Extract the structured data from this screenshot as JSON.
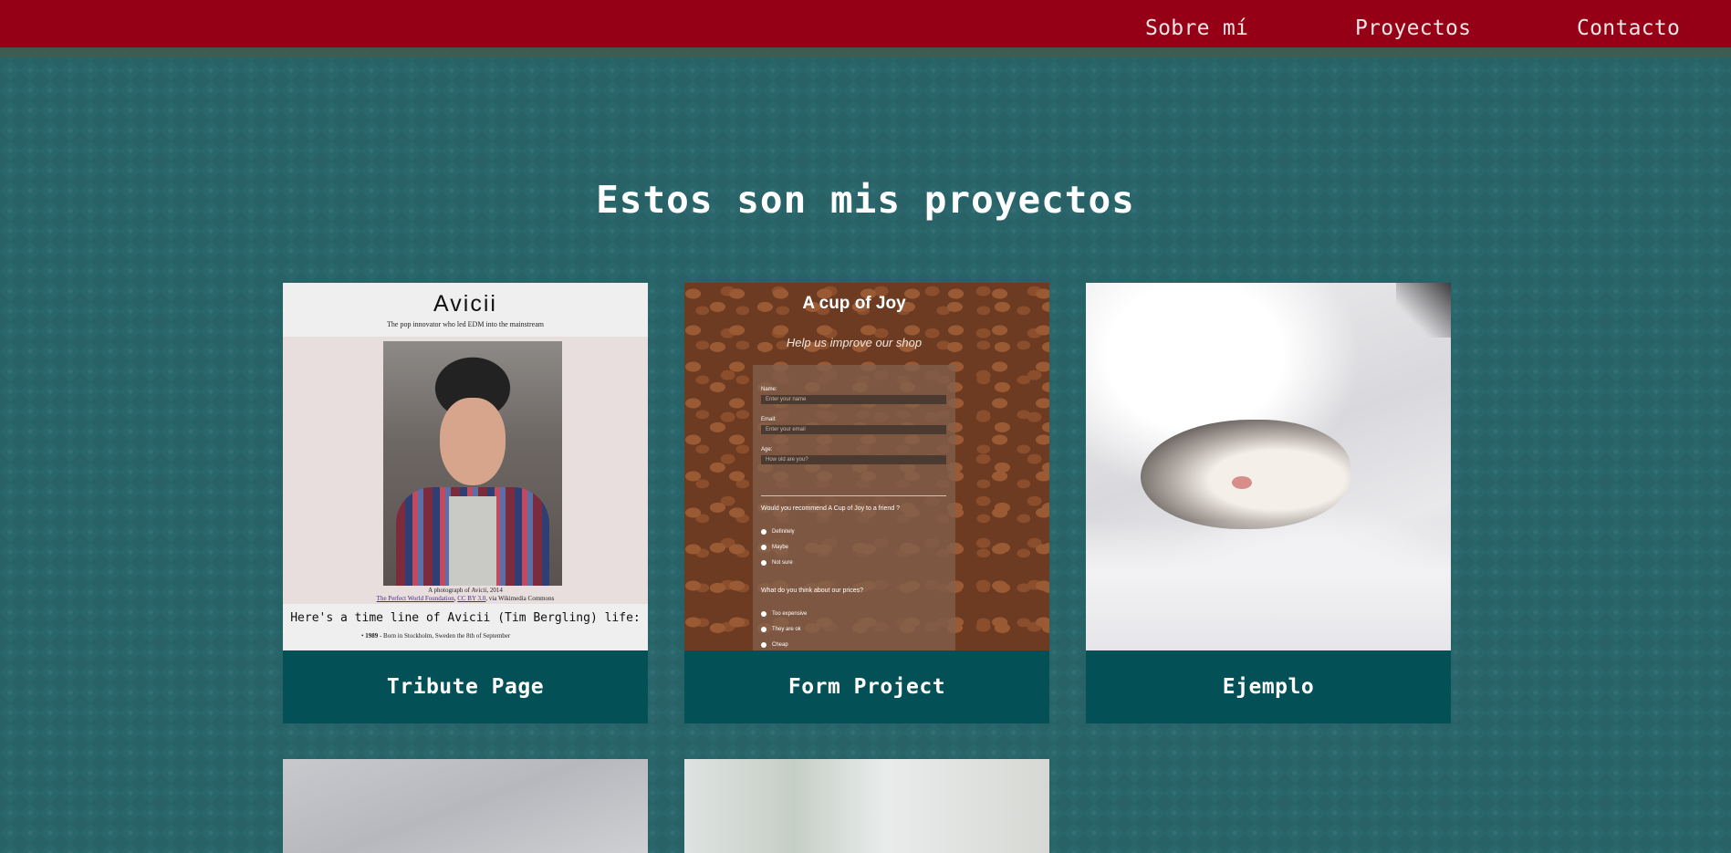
{
  "nav": {
    "links": [
      "Sobre mí",
      "Proyectos",
      "Contacto"
    ]
  },
  "colors": {
    "navbar": "#960016",
    "navbar_border": "#3b5d52",
    "background": "#2a676d",
    "caption": "#035156",
    "text": "#ffffff"
  },
  "projects": {
    "title": "Estos son mis proyectos",
    "cards": [
      {
        "caption": "Tribute Page",
        "thumb": {
          "title": "Avicii",
          "subtitle": "The pop innovator who led EDM into the mainstream",
          "photo_caption_line1": "A photograph of Avicii, 2014",
          "photo_caption_link1": "The Perfect World Foundation",
          "photo_caption_link2": "CC BY 3.0",
          "photo_caption_tail": ", via Wikimedia Commons",
          "timeline_heading": "Here's a time line of Avicii (Tim Bergling) life:",
          "timeline_year": "1989",
          "timeline_text": " - Born in Stockholm, Sweden the 8th of September"
        }
      },
      {
        "caption": "Form Project",
        "thumb": {
          "title": "A cup of Joy",
          "subtitle": "Help us improve our shop",
          "name_label": "Name:",
          "name_placeholder": "Enter your name",
          "email_label": "Email:",
          "email_placeholder": "Enter your email",
          "age_label": "Age:",
          "age_placeholder": "How old are you?",
          "q1": "Would you recommend A Cup of Joy to a friend ?",
          "q1_options": [
            "Definitely",
            "Maybe",
            "Not sure"
          ],
          "q2": "What do you think about our prices?",
          "q2_options": [
            "Too expensive",
            "They are ok",
            "Cheap"
          ]
        }
      },
      {
        "caption": "Ejemplo",
        "thumb": {}
      }
    ]
  }
}
